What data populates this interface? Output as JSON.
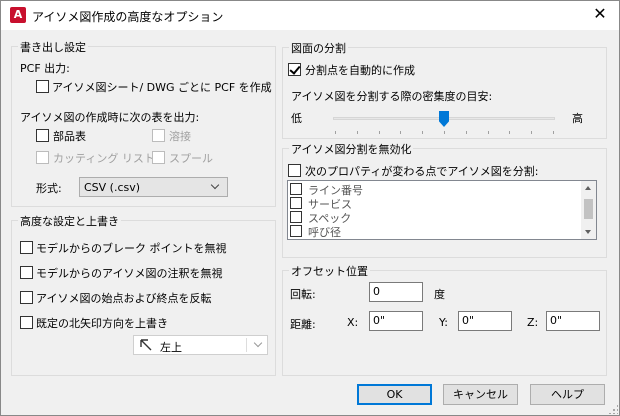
{
  "window": {
    "title": "アイソメ図作成の高度なオプション",
    "app_icon_letter": "A",
    "close_glyph": "✕"
  },
  "export": {
    "label": "書き出し設定",
    "pcf_label": "PCF 出力:",
    "pcf_sheet": "アイソメ図シート/ DWG ごとに PCF を作成",
    "tables_label": "アイソメ図の作成時に次の表を出力:",
    "bom": "部品表",
    "weld": "溶接",
    "cutlist": "カッティング リスト",
    "spool": "スプール",
    "format_label": "形式:",
    "format_value": "CSV (.csv)"
  },
  "advanced": {
    "label": "高度な設定と上書き",
    "ignore_breaks": "モデルからのブレーク ポイントを無視",
    "ignore_annotations": "モデルからのアイソメ図の注釈を無視",
    "reverse_ends": "アイソメ図の始点および終点を反転",
    "override_north": "既定の北矢印方向を上書き",
    "north_value": "左上"
  },
  "split": {
    "label": "図面の分割",
    "auto_split": "分割点を自動的に作成",
    "density_label": "アイソメ図を分割する際の密集度の目安:",
    "low": "低",
    "high": "高",
    "density_level": 0.5
  },
  "disable": {
    "label": "アイソメ図分割を無効化",
    "prop_change": "次のプロパティが変わる点でアイソメ図を分割:",
    "props": [
      "ライン番号",
      "サービス",
      "スペック",
      "呼び径"
    ]
  },
  "offset": {
    "label": "オフセット位置",
    "rotation_label": "回転:",
    "rotation_value": "0",
    "degree": "度",
    "distance_label": "距離:",
    "x_label": "X:",
    "x_value": "0\"",
    "y_label": "Y:",
    "y_value": "0\"",
    "z_label": "Z:",
    "z_value": "0\""
  },
  "buttons": {
    "ok": "OK",
    "cancel": "キャンセル",
    "help": "ヘルプ"
  }
}
